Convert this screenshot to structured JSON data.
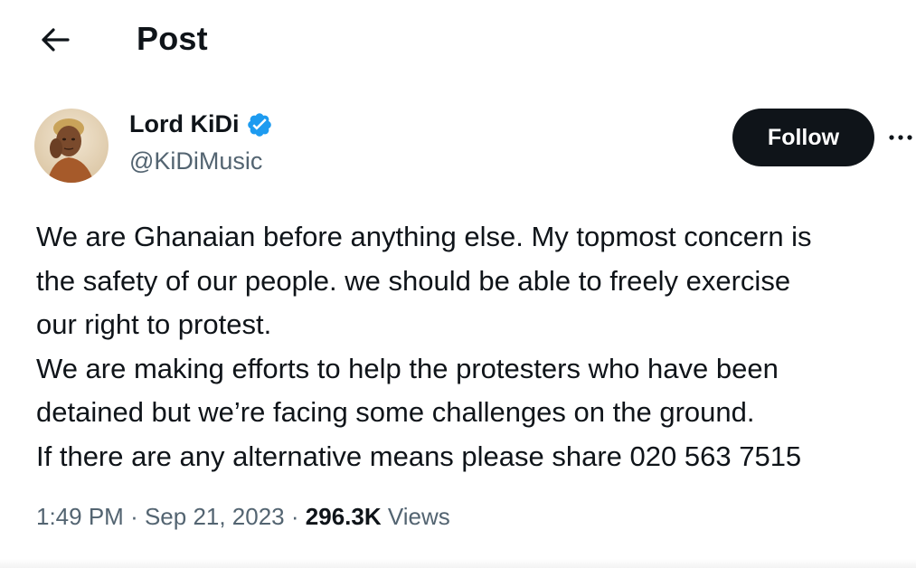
{
  "header": {
    "title": "Post",
    "back_icon": "arrow-left-icon"
  },
  "author": {
    "name": "Lord KiDi",
    "handle": "@KiDiMusic",
    "verified": true,
    "verified_color": "#1d9bf0",
    "avatar_icon": "avatar-photo"
  },
  "actions": {
    "follow_label": "Follow",
    "more_icon": "more-horizontal-icon"
  },
  "tweet": {
    "lines": [
      "We are Ghanaian before anything else. My topmost concern is",
      "the safety of our people. we should be able to freely exercise",
      "our right to protest.",
      "We are making efforts to help the protesters who have been",
      "detained but we’re facing some challenges on the ground.",
      "If there are any alternative means please share 020 563 7515"
    ]
  },
  "meta": {
    "time": "1:49 PM",
    "separator": "·",
    "date": "Sep 21, 2023",
    "views_count": "296.3K",
    "views_label": "Views"
  },
  "colors": {
    "text_primary": "#0f1419",
    "text_secondary": "#536471",
    "follow_bg": "#0f1419",
    "follow_text": "#ffffff"
  }
}
